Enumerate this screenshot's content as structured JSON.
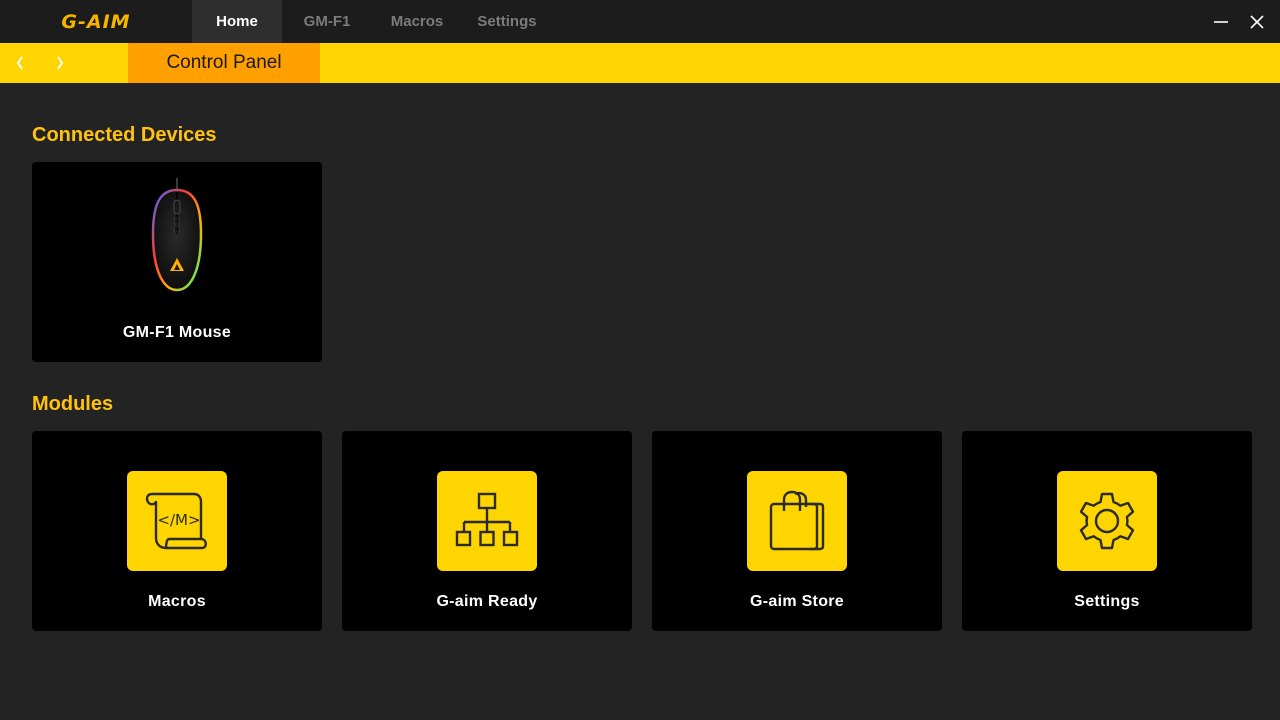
{
  "app": {
    "logo": "G-AIM"
  },
  "tabs": [
    {
      "label": "Home",
      "active": true
    },
    {
      "label": "GM-F1",
      "active": false
    },
    {
      "label": "Macros",
      "active": false
    },
    {
      "label": "Settings",
      "active": false
    }
  ],
  "window_controls": {
    "minimize_icon": "minimize-icon",
    "close_icon": "close-icon"
  },
  "navbar": {
    "back_icon": "chevron-left-icon",
    "forward_icon": "chevron-right-icon",
    "breadcrumb": "Control Panel"
  },
  "connected_devices": {
    "title": "Connected Devices",
    "devices": [
      {
        "label": "GM-F1  Mouse",
        "icon": "gaming-mouse-image"
      }
    ]
  },
  "modules": {
    "title": "Modules",
    "items": [
      {
        "label": "Macros",
        "icon": "macro-scroll-icon"
      },
      {
        "label": "G-aim Ready",
        "icon": "network-hierarchy-icon"
      },
      {
        "label": "G-aim Store",
        "icon": "shopping-bag-icon"
      },
      {
        "label": "Settings",
        "icon": "gear-icon"
      }
    ]
  },
  "colors": {
    "accent_yellow": "#ffd500",
    "breadcrumb_orange": "#ff9f00",
    "section_title": "#ffc20e",
    "background": "#232323",
    "titlebar": "#1c1c1c",
    "card": "#000000"
  }
}
